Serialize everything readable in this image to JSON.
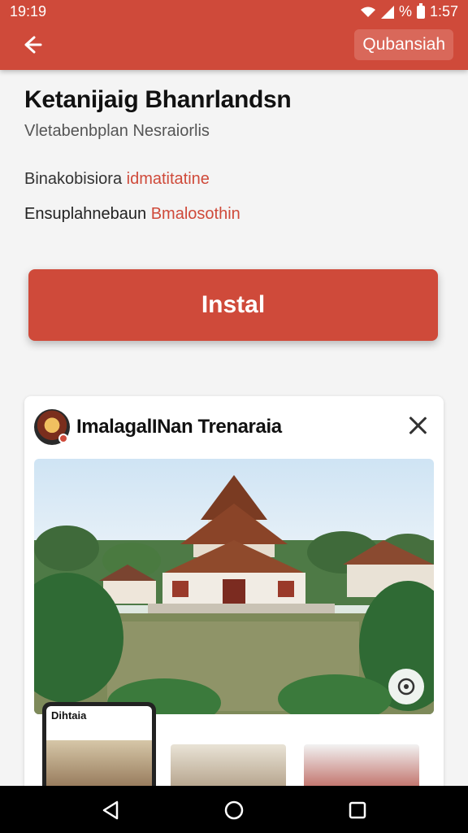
{
  "status_bar": {
    "time_left": "19:19",
    "right_text": "%",
    "time_right": "1:57"
  },
  "app_bar": {
    "action_chip": "Qubansiah"
  },
  "header": {
    "title": "Ketanijaig Bhanrlandsn",
    "subtitle": "Vletabenbplan Nesraiorlis",
    "row1_prefix": "Binakobisiora ",
    "row1_accent": "idmatitatine",
    "row2_prefix": "Ensuplahnebaun ",
    "row2_accent": "Bmalosothin"
  },
  "install_button": {
    "label": "Instal"
  },
  "promo_card": {
    "title": "ImalagalINan Trenaraia",
    "preview_label": "Dihtaia"
  },
  "colors": {
    "accent": "#cf4a3a",
    "background": "#f4f4f4"
  },
  "icons": {
    "back": "arrow-left-icon",
    "close": "close-icon",
    "lens": "lens-icon",
    "nav_back": "triangle-back-icon",
    "nav_home": "circle-home-icon",
    "nav_recent": "square-recent-icon"
  }
}
